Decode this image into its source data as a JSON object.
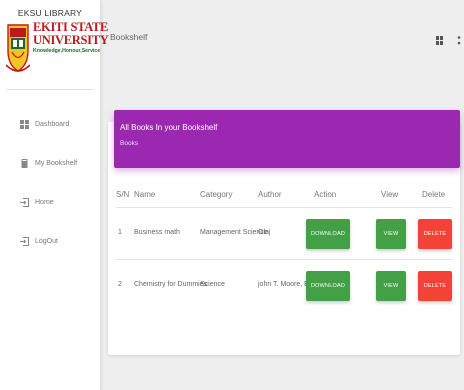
{
  "sidebar": {
    "brand_top": "EKSU LIBRARY",
    "logo_line1": "EKITI STATE",
    "logo_line2": "UNIVERSITY",
    "motto": "Knowledge,Honour,Service",
    "items": [
      {
        "label": "Dashboard",
        "icon": "dashboard-icon"
      },
      {
        "label": "My Bookshelf",
        "icon": "bookshelf-icon"
      },
      {
        "label": "Home",
        "icon": "home-icon"
      },
      {
        "label": "LogOut",
        "icon": "logout-icon"
      }
    ]
  },
  "header": {
    "title": "Bookshelf",
    "icons": [
      "stats-icon",
      "more-vert-icon"
    ]
  },
  "card": {
    "title": "All Books In your Bookshelf",
    "subtitle": "Books",
    "header_color": "#9c27b0"
  },
  "table": {
    "columns": [
      "S/N",
      "Name",
      "Category",
      "Author",
      "Action",
      "View",
      "Delete"
    ],
    "rows": [
      {
        "sn": "1",
        "name": "Business math",
        "category": "Management Science",
        "author": "Olaj",
        "action": "DOWNLOAD",
        "view": "VIEW",
        "delete": "DELETE"
      },
      {
        "sn": "2",
        "name": "Chemistry for Dummies",
        "category": "Science",
        "author": "john T. Moore, EDD",
        "action": "DOWNLOAD",
        "view": "VIEW",
        "delete": "DELETE"
      }
    ]
  },
  "colors": {
    "download": "#43a047",
    "view": "#43a047",
    "delete": "#f44336"
  }
}
